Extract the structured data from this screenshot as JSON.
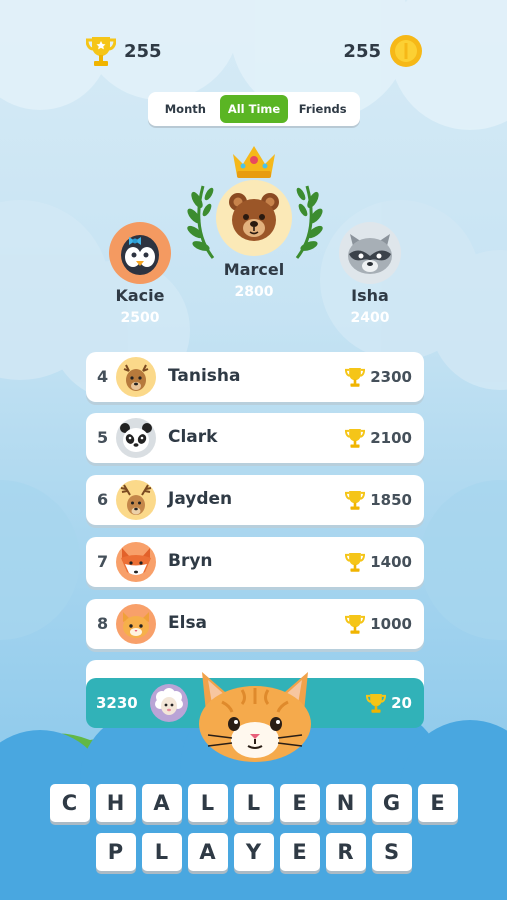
{
  "header": {
    "trophies": "255",
    "coins": "255",
    "trophy_icon": "trophy-icon",
    "coin_icon": "coin-icon"
  },
  "tabs": [
    {
      "label": "Month",
      "active": false
    },
    {
      "label": "All Time",
      "active": true
    },
    {
      "label": "Friends",
      "active": false
    }
  ],
  "podium": {
    "first": {
      "name": "Marcel",
      "score": "2800",
      "avatar": "bear"
    },
    "second": {
      "name": "Kacie",
      "score": "2500",
      "avatar": "penguin"
    },
    "third": {
      "name": "Isha",
      "score": "2400",
      "avatar": "raccoon"
    }
  },
  "leaderboard": [
    {
      "rank": "4",
      "name": "Tanisha",
      "score": "2300",
      "avatar": "deer"
    },
    {
      "rank": "5",
      "name": "Clark",
      "score": "2100",
      "avatar": "panda"
    },
    {
      "rank": "6",
      "name": "Jayden",
      "score": "1850",
      "avatar": "reindeer"
    },
    {
      "rank": "7",
      "name": "Bryn",
      "score": "1400",
      "avatar": "fox"
    },
    {
      "rank": "8",
      "name": "Elsa",
      "score": "1000",
      "avatar": "cat"
    }
  ],
  "me": {
    "rank": "3230",
    "score": "20",
    "avatar": "sheep"
  },
  "challenge": {
    "line1": [
      "C",
      "H",
      "A",
      "L",
      "L",
      "E",
      "N",
      "G",
      "E"
    ],
    "line2": [
      "P",
      "L",
      "A",
      "Y",
      "E",
      "R",
      "S"
    ]
  },
  "colors": {
    "accent_green": "#5ab524",
    "trophy_gold": "#f5c518",
    "me_bar": "#31b2b8"
  }
}
